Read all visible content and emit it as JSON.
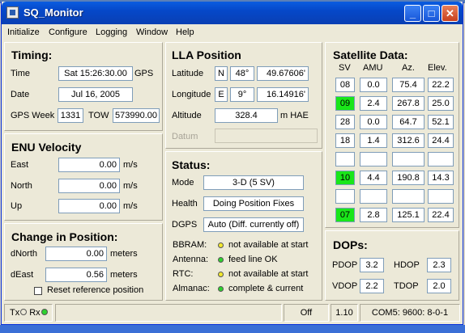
{
  "window": {
    "title": "SQ_Monitor"
  },
  "menu": [
    "Initialize",
    "Configure",
    "Logging",
    "Window",
    "Help"
  ],
  "timing": {
    "title": "Timing:",
    "time_label": "Time",
    "time_value": "Sat 15:26:30.00",
    "time_unit": "GPS",
    "date_label": "Date",
    "date_value": "Jul 16, 2005",
    "week_label": "GPS Week",
    "week_value": "1331",
    "tow_label": "TOW",
    "tow_value": "573990.00"
  },
  "enu": {
    "title": "ENU Velocity",
    "rows": [
      {
        "label": "East",
        "value": "0.00",
        "unit": "m/s"
      },
      {
        "label": "North",
        "value": "0.00",
        "unit": "m/s"
      },
      {
        "label": "Up",
        "value": "0.00",
        "unit": "m/s"
      }
    ]
  },
  "change": {
    "title": "Change in Position:",
    "rows": [
      {
        "label": "dNorth",
        "value": "0.00",
        "unit": "meters"
      },
      {
        "label": "dEast",
        "value": "0.56",
        "unit": "meters"
      }
    ],
    "reset_label": "Reset reference position"
  },
  "lla": {
    "title": "LLA Position",
    "lat_label": "Latitude",
    "lat_hemi": "N",
    "lat_deg": "48°",
    "lat_min": "49.67606'",
    "lon_label": "Longitude",
    "lon_hemi": "E",
    "lon_deg": "9°",
    "lon_min": "16.14916'",
    "alt_label": "Altitude",
    "alt_value": "328.4",
    "alt_unit": "m HAE",
    "datum_label": "Datum"
  },
  "status": {
    "title": "Status:",
    "mode_label": "Mode",
    "mode_value": "3-D  (5 SV)",
    "health_label": "Health",
    "health_value": "Doing Position Fixes",
    "dgps_label": "DGPS",
    "dgps_value": "Auto (Diff. currently off)",
    "indicators": [
      {
        "label": "BBRAM:",
        "text": "not available at start",
        "color": "#f2e82e"
      },
      {
        "label": "Antenna:",
        "text": "feed line OK",
        "color": "#2ed22e"
      },
      {
        "label": "RTC:",
        "text": "not available at start",
        "color": "#f2e82e"
      },
      {
        "label": "Almanac:",
        "text": "complete & current",
        "color": "#2ed22e"
      }
    ]
  },
  "sat": {
    "title": "Satellite Data:",
    "headers": [
      "SV",
      "AMU",
      "Az.",
      "Elev."
    ],
    "rows": [
      {
        "sv": "08",
        "amu": "0.0",
        "az": "75.4",
        "elev": "22.2",
        "tracked": false
      },
      {
        "sv": "09",
        "amu": "2.4",
        "az": "267.8",
        "elev": "25.0",
        "tracked": true
      },
      {
        "sv": "28",
        "amu": "0.0",
        "az": "64.7",
        "elev": "52.1",
        "tracked": false
      },
      {
        "sv": "18",
        "amu": "1.4",
        "az": "312.6",
        "elev": "24.4",
        "tracked": false
      },
      {
        "sv": "",
        "amu": "",
        "az": "",
        "elev": "",
        "tracked": false
      },
      {
        "sv": "10",
        "amu": "4.4",
        "az": "190.8",
        "elev": "14.3",
        "tracked": true
      },
      {
        "sv": "",
        "amu": "",
        "az": "",
        "elev": "",
        "tracked": false
      },
      {
        "sv": "07",
        "amu": "2.8",
        "az": "125.1",
        "elev": "22.4",
        "tracked": true
      }
    ]
  },
  "dops": {
    "title": "DOPs:",
    "pdop_label": "PDOP",
    "pdop": "3.2",
    "hdop_label": "HDOP",
    "hdop": "2.3",
    "vdop_label": "VDOP",
    "vdop": "2.2",
    "tdop_label": "TDOP",
    "tdop": "2.0"
  },
  "statusbar": {
    "tx": "Tx",
    "rx": "Rx",
    "off": "Off",
    "version": "1.10",
    "port": "COM5: 9600: 8-0-1"
  }
}
